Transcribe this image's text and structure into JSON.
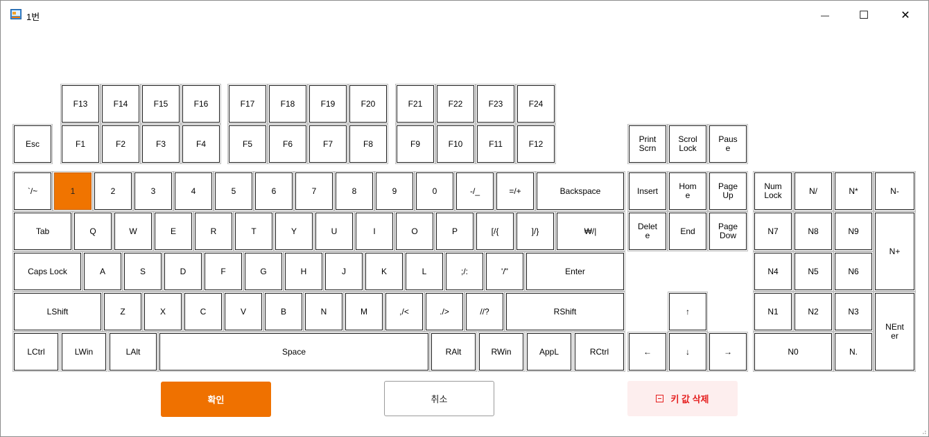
{
  "window": {
    "title": "1번",
    "controls": {
      "minimize": "—",
      "maximize": "☐",
      "close": "✕"
    }
  },
  "keyboard": {
    "selected_key": "1",
    "keys": [
      {
        "id": "f13",
        "label": "F13"
      },
      {
        "id": "f14",
        "label": "F14"
      },
      {
        "id": "f15",
        "label": "F15"
      },
      {
        "id": "f16",
        "label": "F16"
      },
      {
        "id": "f17",
        "label": "F17"
      },
      {
        "id": "f18",
        "label": "F18"
      },
      {
        "id": "f19",
        "label": "F19"
      },
      {
        "id": "f20",
        "label": "F20"
      },
      {
        "id": "f21",
        "label": "F21"
      },
      {
        "id": "f22",
        "label": "F22"
      },
      {
        "id": "f23",
        "label": "F23"
      },
      {
        "id": "f24",
        "label": "F24"
      },
      {
        "id": "esc",
        "label": "Esc"
      },
      {
        "id": "f1",
        "label": "F1"
      },
      {
        "id": "f2",
        "label": "F2"
      },
      {
        "id": "f3",
        "label": "F3"
      },
      {
        "id": "f4",
        "label": "F4"
      },
      {
        "id": "f5",
        "label": "F5"
      },
      {
        "id": "f6",
        "label": "F6"
      },
      {
        "id": "f7",
        "label": "F7"
      },
      {
        "id": "f8",
        "label": "F8"
      },
      {
        "id": "f9",
        "label": "F9"
      },
      {
        "id": "f10",
        "label": "F10"
      },
      {
        "id": "f11",
        "label": "F11"
      },
      {
        "id": "f12",
        "label": "F12"
      },
      {
        "id": "printscrn",
        "label": "Print\nScrn"
      },
      {
        "id": "scrolllock",
        "label": "Scrol\nLock"
      },
      {
        "id": "pause",
        "label": "Paus\ne"
      },
      {
        "id": "grave",
        "label": "`/~"
      },
      {
        "id": "1",
        "label": "1"
      },
      {
        "id": "2",
        "label": "2"
      },
      {
        "id": "3",
        "label": "3"
      },
      {
        "id": "4",
        "label": "4"
      },
      {
        "id": "5",
        "label": "5"
      },
      {
        "id": "6",
        "label": "6"
      },
      {
        "id": "7",
        "label": "7"
      },
      {
        "id": "8",
        "label": "8"
      },
      {
        "id": "9",
        "label": "9"
      },
      {
        "id": "0",
        "label": "0"
      },
      {
        "id": "minus",
        "label": "-/_"
      },
      {
        "id": "equal",
        "label": "=/+"
      },
      {
        "id": "backspace",
        "label": "Backspace"
      },
      {
        "id": "insert",
        "label": "Insert"
      },
      {
        "id": "home",
        "label": "Hom\ne"
      },
      {
        "id": "pageup",
        "label": "Page\nUp"
      },
      {
        "id": "numlock",
        "label": "Num\nLock"
      },
      {
        "id": "ndiv",
        "label": "N/"
      },
      {
        "id": "nmul",
        "label": "N*"
      },
      {
        "id": "nminus",
        "label": "N-"
      },
      {
        "id": "tab",
        "label": "Tab"
      },
      {
        "id": "q",
        "label": "Q"
      },
      {
        "id": "w",
        "label": "W"
      },
      {
        "id": "e",
        "label": "E"
      },
      {
        "id": "r",
        "label": "R"
      },
      {
        "id": "t",
        "label": "T"
      },
      {
        "id": "y",
        "label": "Y"
      },
      {
        "id": "u",
        "label": "U"
      },
      {
        "id": "i",
        "label": "I"
      },
      {
        "id": "o",
        "label": "O"
      },
      {
        "id": "p",
        "label": "P"
      },
      {
        "id": "lbracket",
        "label": "[/{"
      },
      {
        "id": "rbracket",
        "label": "]/}"
      },
      {
        "id": "backslash",
        "label": "₩/|"
      },
      {
        "id": "delete",
        "label": "Delet\ne"
      },
      {
        "id": "end",
        "label": "End"
      },
      {
        "id": "pagedown",
        "label": "Page\nDow"
      },
      {
        "id": "n7",
        "label": "N7"
      },
      {
        "id": "n8",
        "label": "N8"
      },
      {
        "id": "n9",
        "label": "N9"
      },
      {
        "id": "nplus",
        "label": "N+"
      },
      {
        "id": "capslock",
        "label": "Caps Lock"
      },
      {
        "id": "a",
        "label": "A"
      },
      {
        "id": "s",
        "label": "S"
      },
      {
        "id": "d",
        "label": "D"
      },
      {
        "id": "f",
        "label": "F"
      },
      {
        "id": "g",
        "label": "G"
      },
      {
        "id": "h",
        "label": "H"
      },
      {
        "id": "j",
        "label": "J"
      },
      {
        "id": "k",
        "label": "K"
      },
      {
        "id": "l",
        "label": "L"
      },
      {
        "id": "semicolon",
        "label": ";/:"
      },
      {
        "id": "quote",
        "label": "'/\""
      },
      {
        "id": "enter",
        "label": "Enter"
      },
      {
        "id": "n4",
        "label": "N4"
      },
      {
        "id": "n5",
        "label": "N5"
      },
      {
        "id": "n6",
        "label": "N6"
      },
      {
        "id": "lshift",
        "label": "LShift"
      },
      {
        "id": "z",
        "label": "Z"
      },
      {
        "id": "x",
        "label": "X"
      },
      {
        "id": "c",
        "label": "C"
      },
      {
        "id": "v",
        "label": "V"
      },
      {
        "id": "b",
        "label": "B"
      },
      {
        "id": "n",
        "label": "N"
      },
      {
        "id": "m",
        "label": "M"
      },
      {
        "id": "comma",
        "label": ",/<"
      },
      {
        "id": "period",
        "label": "./>"
      },
      {
        "id": "slash",
        "label": "//?"
      },
      {
        "id": "rshift",
        "label": "RShift"
      },
      {
        "id": "up",
        "label": "↑"
      },
      {
        "id": "n1",
        "label": "N1"
      },
      {
        "id": "n2",
        "label": "N2"
      },
      {
        "id": "n3",
        "label": "N3"
      },
      {
        "id": "nenter",
        "label": "NEnt\ner"
      },
      {
        "id": "lctrl",
        "label": "LCtrl"
      },
      {
        "id": "lwin",
        "label": "LWin"
      },
      {
        "id": "lalt",
        "label": "LAlt"
      },
      {
        "id": "space",
        "label": "Space"
      },
      {
        "id": "ralt",
        "label": "RAlt"
      },
      {
        "id": "rwin",
        "label": "RWin"
      },
      {
        "id": "appl",
        "label": "AppL"
      },
      {
        "id": "rctrl",
        "label": "RCtrl"
      },
      {
        "id": "left",
        "label": "←"
      },
      {
        "id": "down",
        "label": "↓"
      },
      {
        "id": "right",
        "label": "→"
      },
      {
        "id": "n0",
        "label": "N0"
      },
      {
        "id": "ndot",
        "label": "N."
      }
    ]
  },
  "actions": {
    "confirm_label": "확인",
    "cancel_label": "취소",
    "delete_label": "키 값 삭제"
  },
  "colors": {
    "accent": "#ef7100",
    "selected_key": "#f07400",
    "delete_bg": "#fdeeee",
    "delete_text": "#e51d1d"
  }
}
